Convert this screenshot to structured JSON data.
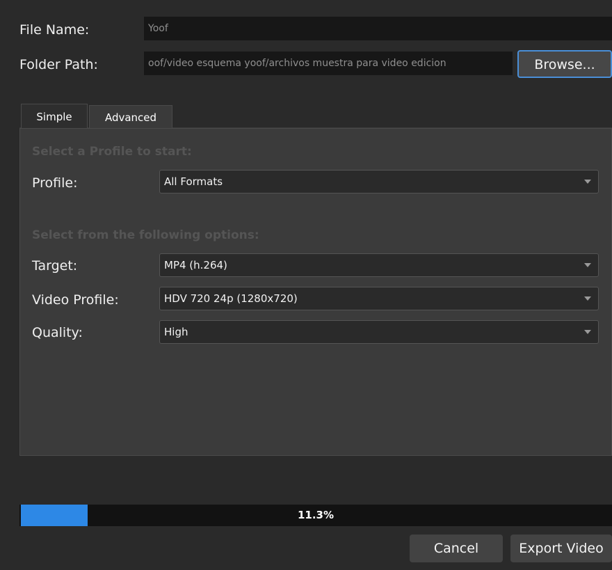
{
  "file_name": {
    "label": "File Name:",
    "value": "Yoof"
  },
  "folder_path": {
    "label": "Folder Path:",
    "value": "oof/video esquema yoof/archivos muestra para video edicion",
    "browse_label": "Browse..."
  },
  "tabs": [
    {
      "label": "Simple",
      "active": true
    },
    {
      "label": "Advanced",
      "active": false
    }
  ],
  "simple": {
    "profile_hint": "Select a Profile to start:",
    "profile": {
      "label": "Profile:",
      "value": "All Formats"
    },
    "options_hint": "Select from the following options:",
    "target": {
      "label": "Target:",
      "value": "MP4 (h.264)"
    },
    "video_profile": {
      "label": "Video Profile:",
      "value": "HDV 720 24p (1280x720)"
    },
    "quality": {
      "label": "Quality:",
      "value": "High"
    }
  },
  "progress": {
    "percent": 11.3,
    "text": "11.3%"
  },
  "buttons": {
    "cancel": "Cancel",
    "export": "Export Video"
  },
  "colors": {
    "accent": "#2d88e6",
    "background": "#2a2a2a",
    "panel": "#3b3b3b"
  }
}
